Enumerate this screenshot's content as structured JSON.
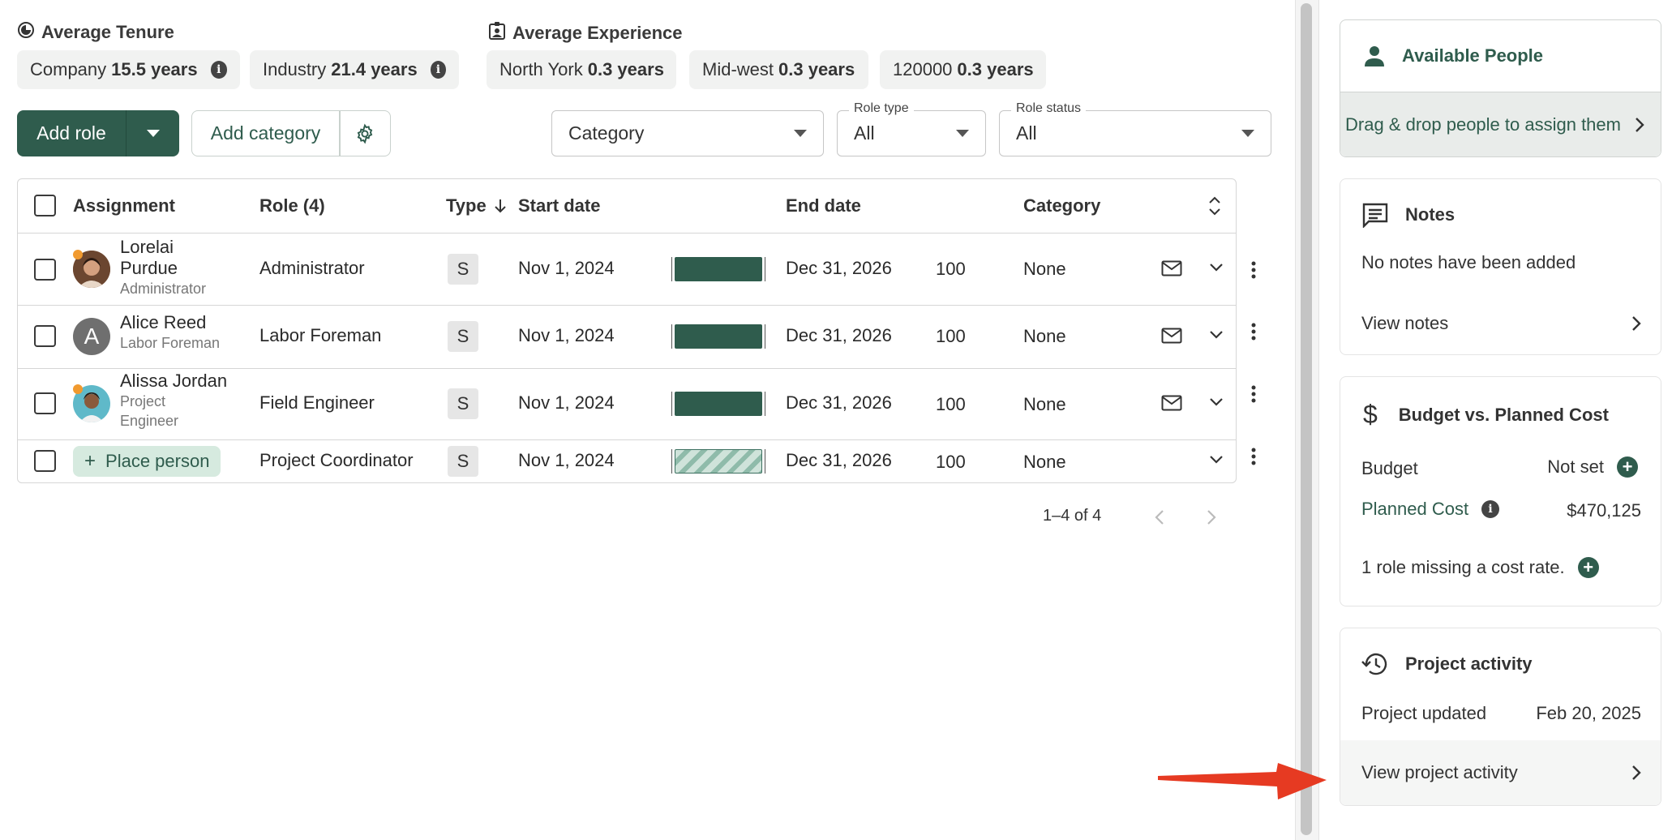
{
  "stats": {
    "tenure_title": "Average Tenure",
    "experience_title": "Average Experience",
    "chips": [
      {
        "label": "Company",
        "value": "15.5 years"
      },
      {
        "label": "Industry",
        "value": "21.4 years"
      },
      {
        "label": "North York",
        "value": "0.3 years"
      },
      {
        "label": "Mid-west",
        "value": "0.3 years"
      },
      {
        "label": "120000",
        "value": "0.3 years"
      }
    ]
  },
  "toolbar": {
    "add_role": "Add role",
    "add_category": "Add category",
    "category_select": "Category",
    "role_type_legend": "Role type",
    "role_type_value": "All",
    "role_status_legend": "Role status",
    "role_status_value": "All"
  },
  "table": {
    "headers": {
      "assignment": "Assignment",
      "role": "Role (4)",
      "type": "Type",
      "start": "Start date",
      "end": "End date",
      "category": "Category"
    },
    "rows": [
      {
        "name_line1": "Lorelai",
        "name_line2": "Purdue",
        "subtitle": "Administrator",
        "role": "Administrator",
        "type": "S",
        "start": "Nov 1, 2024",
        "end": "Dec 31, 2026",
        "percent": "100",
        "category": "None"
      },
      {
        "name_line1": "Alice Reed",
        "subtitle": "Labor Foreman",
        "avatar_letter": "A",
        "role": "Labor Foreman",
        "type": "S",
        "start": "Nov 1, 2024",
        "end": "Dec 31, 2026",
        "percent": "100",
        "category": "None"
      },
      {
        "name_line1": "Alissa Jordan",
        "sub_line1": "Project",
        "sub_line2": "Engineer",
        "role": "Field Engineer",
        "type": "S",
        "start": "Nov 1, 2024",
        "end": "Dec 31, 2026",
        "percent": "100",
        "category": "None"
      },
      {
        "place_label": "Place person",
        "role": "Project Coordinator",
        "type": "S",
        "start": "Nov 1, 2024",
        "end": "Dec 31, 2026",
        "percent": "100",
        "category": "None"
      }
    ],
    "pagination": "1–4 of 4"
  },
  "panel": {
    "available": {
      "title": "Available People",
      "drag_text": "Drag & drop people to assign them"
    },
    "notes": {
      "title": "Notes",
      "empty": "No notes have been added",
      "view": "View notes"
    },
    "budget": {
      "title": "Budget vs. Planned Cost",
      "budget_label": "Budget",
      "budget_value": "Not set",
      "planned_label": "Planned Cost",
      "planned_value": "$470,125",
      "missing": "1 role missing a cost rate."
    },
    "activity": {
      "title": "Project activity",
      "updated_label": "Project updated",
      "updated_value": "Feb 20, 2025",
      "view": "View project activity"
    }
  },
  "colors": {
    "brand": "#2f5c4d",
    "arrow": "#e63a22",
    "accent_dot": "#f19a2f"
  }
}
